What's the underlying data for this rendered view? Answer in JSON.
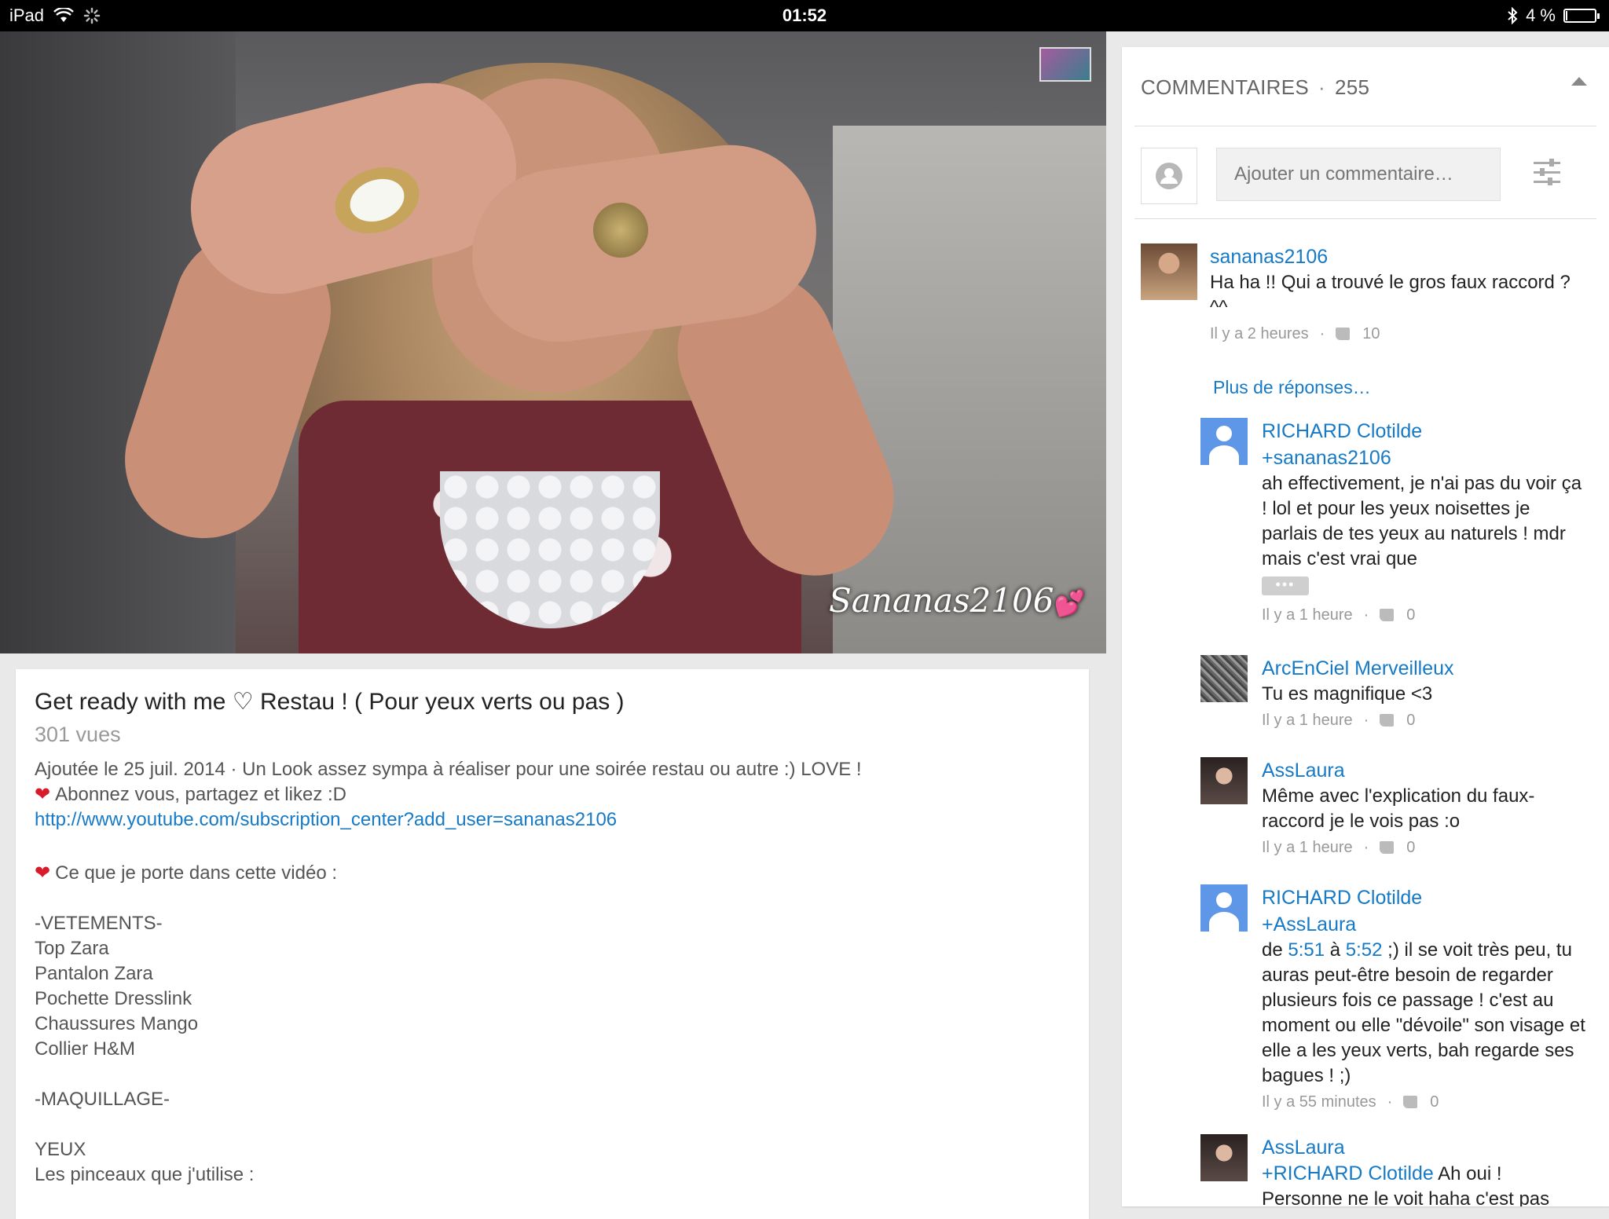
{
  "statusbar": {
    "device": "iPad",
    "time": "01:52",
    "battery_text": "4 %",
    "battery_level": 0.04,
    "icons": [
      "wifi-icon",
      "activity-spinner-icon",
      "bluetooth-icon",
      "battery-icon"
    ]
  },
  "video": {
    "watermark": "Sananas2106",
    "watermark_heart": "💕"
  },
  "description": {
    "title": "Get ready with me ♡ Restau ! ( Pour yeux verts ou pas )",
    "views": "301 vues",
    "added": "Ajoutée le 25 juil. 2014 · Un Look assez sympa à réaliser pour une soirée restau ou autre :) LOVE !",
    "subscribe_line": "Abonnez vous, partagez et likez :D",
    "subscribe_link": "http://www.youtube.com/subscription_center?add_user=sananas2106",
    "wearing_line": "Ce que je porte dans cette vidéo :",
    "clothes_header": "-VETEMENTS-",
    "clothes": [
      "Top Zara",
      "Pantalon Zara",
      "Pochette Dresslink",
      "Chaussures Mango",
      "Collier H&M"
    ],
    "makeup_header": "-MAQUILLAGE-",
    "eyes_header": "YEUX",
    "brushes_line": "Les pinceaux que j'utilise :"
  },
  "comments": {
    "header_label": "COMMENTAIRES",
    "count": "255",
    "input_placeholder": "Ajouter un commentaire…",
    "more_replies": "Plus de réponses…",
    "items": [
      {
        "author": "sananas2106",
        "text": "Ha ha !! Qui a trouvé le gros faux raccord ? ^^",
        "time": "Il y a 2 heures",
        "likes": "10"
      },
      {
        "author": "RICHARD Clotilde",
        "mention": "+sananas2106",
        "text": " ah effectivement, je n'ai pas du voir ça ! lol et pour les yeux noisettes je parlais de tes yeux au naturels ! mdr mais c'est vrai que",
        "more": "•••",
        "time": "Il y a 1 heure",
        "likes": "0"
      },
      {
        "author": "ArcEnCiel Merveilleux",
        "text": "Tu es magnifique <3",
        "time": "Il y a 1 heure",
        "likes": "0"
      },
      {
        "author": "AssLaura",
        "text": "Même avec l'explication du faux-raccord je le vois pas :o",
        "time": "Il y a 1 heure",
        "likes": "0"
      },
      {
        "author": "RICHARD Clotilde",
        "mention": "+AssLaura",
        "text_prefix": "de ",
        "ts1": "5:51",
        "text_mid": " à ",
        "ts2": "5:52",
        "text_rest": " ;) il se voit très peu, tu auras peut-être besoin de regarder plusieurs fois ce passage ! c'est au moment ou elle \"dévoile\" son visage et elle a les yeux verts, bah regarde ses bagues ! ;)",
        "time": "Il y a 55 minutes",
        "likes": "0"
      },
      {
        "author": "AssLaura",
        "mention": "+RICHARD Clotilde",
        "text_after_mention": " Ah oui !",
        "text": "Personne ne le voit haha c'est pas"
      }
    ]
  }
}
